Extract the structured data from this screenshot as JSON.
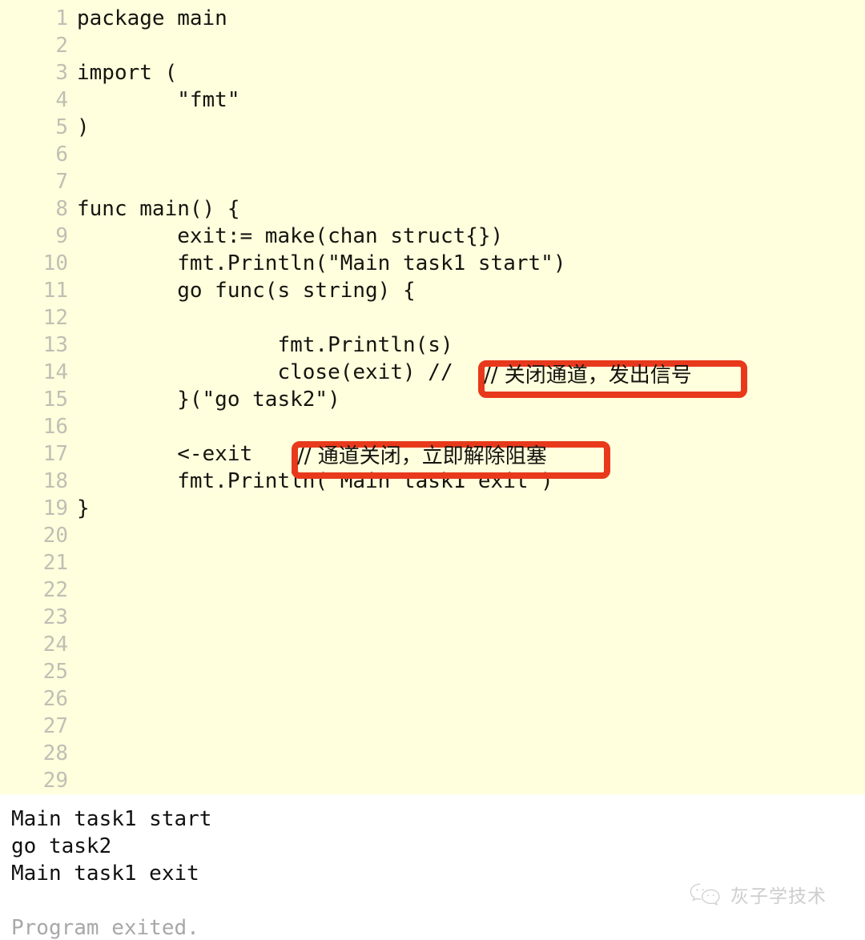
{
  "editor": {
    "background_color": "#ffffdd",
    "line_number_color": "#bfbfb4",
    "text_color": "#15140f",
    "language": "go",
    "lines": [
      {
        "n": "1",
        "text": "package main"
      },
      {
        "n": "2",
        "text": ""
      },
      {
        "n": "3",
        "text": "import ("
      },
      {
        "n": "4",
        "text": "        \"fmt\""
      },
      {
        "n": "5",
        "text": ")"
      },
      {
        "n": "6",
        "text": ""
      },
      {
        "n": "7",
        "text": ""
      },
      {
        "n": "8",
        "text": "func main() {"
      },
      {
        "n": "9",
        "text": "        exit:= make(chan struct{})"
      },
      {
        "n": "10",
        "text": "        fmt.Println(\"Main task1 start\")"
      },
      {
        "n": "11",
        "text": "        go func(s string) {"
      },
      {
        "n": "12",
        "text": ""
      },
      {
        "n": "13",
        "text": "                fmt.Println(s)"
      },
      {
        "n": "14",
        "text": "                close(exit) //"
      },
      {
        "n": "15",
        "text": "        }(\"go task2\")"
      },
      {
        "n": "16",
        "text": ""
      },
      {
        "n": "17",
        "text": "        <-exit  "
      },
      {
        "n": "18",
        "text": "        fmt.Println(\"Main task1 exit\")"
      },
      {
        "n": "19",
        "text": "}"
      },
      {
        "n": "20",
        "text": ""
      },
      {
        "n": "21",
        "text": ""
      },
      {
        "n": "22",
        "text": ""
      },
      {
        "n": "23",
        "text": ""
      },
      {
        "n": "24",
        "text": ""
      },
      {
        "n": "25",
        "text": ""
      },
      {
        "n": "26",
        "text": ""
      },
      {
        "n": "27",
        "text": ""
      },
      {
        "n": "28",
        "text": ""
      },
      {
        "n": "29",
        "text": ""
      }
    ]
  },
  "annotations": {
    "highlight_color": "#e8391c",
    "boxes": [
      {
        "id": "close-comment",
        "line": "14",
        "comment": "// 关闭通道，发出信号"
      },
      {
        "id": "receive-comment",
        "line": "17",
        "comment": "// 通道关闭，立即解除阻塞"
      }
    ]
  },
  "output": {
    "background_color": "#ffffff",
    "lines": [
      {
        "text": "Main task1 start",
        "muted": false
      },
      {
        "text": "go task2",
        "muted": false
      },
      {
        "text": "Main task1 exit",
        "muted": false
      },
      {
        "text": "",
        "muted": false
      },
      {
        "text": "Program exited.",
        "muted": true
      }
    ]
  },
  "watermark": {
    "icon": "wechat-icon",
    "label": "灰子学技术",
    "color": "#c9c9c9"
  }
}
